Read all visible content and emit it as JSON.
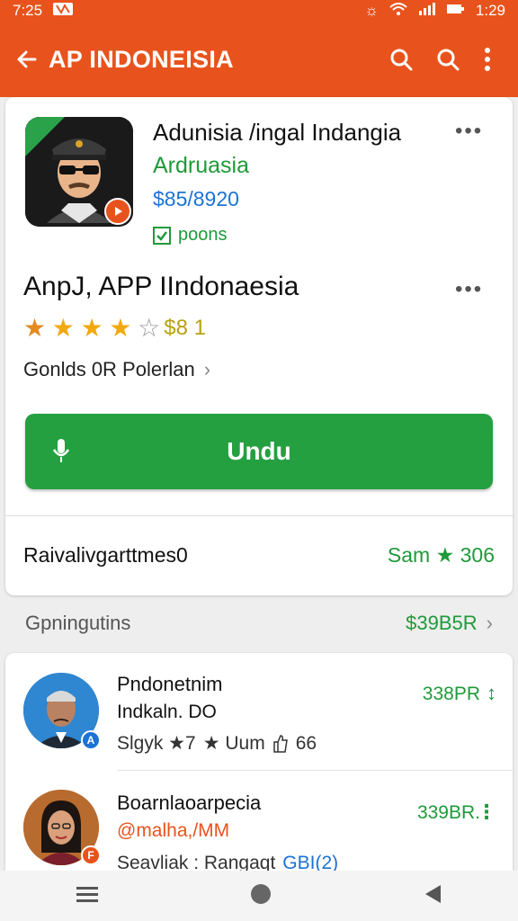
{
  "status": {
    "time_left": "7:25",
    "time_right": "1:29"
  },
  "appbar": {
    "title": "AP INDONEISIA",
    "back_icon": "arrow-left-icon",
    "search_icon": "search-icon",
    "menu_icon": "more-vert-icon"
  },
  "app": {
    "name": "Adunisia /ingal Indangia",
    "developer": "Ardruasia",
    "price": "$85/8920",
    "tag": "poons",
    "headline": "AnpJ, APP IIndonaesia",
    "rating_value": "$8 1",
    "rating_stars": 4,
    "info_text": "Gonlds 0R Polerlan",
    "install_label": "Undu",
    "bottom_left": "Raivalivgarttmes0",
    "bottom_right": "Sam ★ 306"
  },
  "section": {
    "title": "Gpningutins",
    "right": "$39B5R"
  },
  "list": [
    {
      "title": "Pndonetnim",
      "subtitle": "Indkaln. DO",
      "meta1": "Slgyk ★7",
      "meta2": "★ Uum",
      "meta3": "66",
      "price": "338PR",
      "more": "↕"
    },
    {
      "title": "Boarnlaoarpecia",
      "subtitle": "@malha,/MM",
      "meta1": "Seavliak : Rangaqt",
      "meta2": "GBI(2)",
      "price": "339BR.",
      "more": "⋮"
    }
  ],
  "colors": {
    "brand": "#e8531d",
    "primary_button": "#25a040",
    "accent_text": "#1f9a3a",
    "link_text": "#1b73d4"
  }
}
